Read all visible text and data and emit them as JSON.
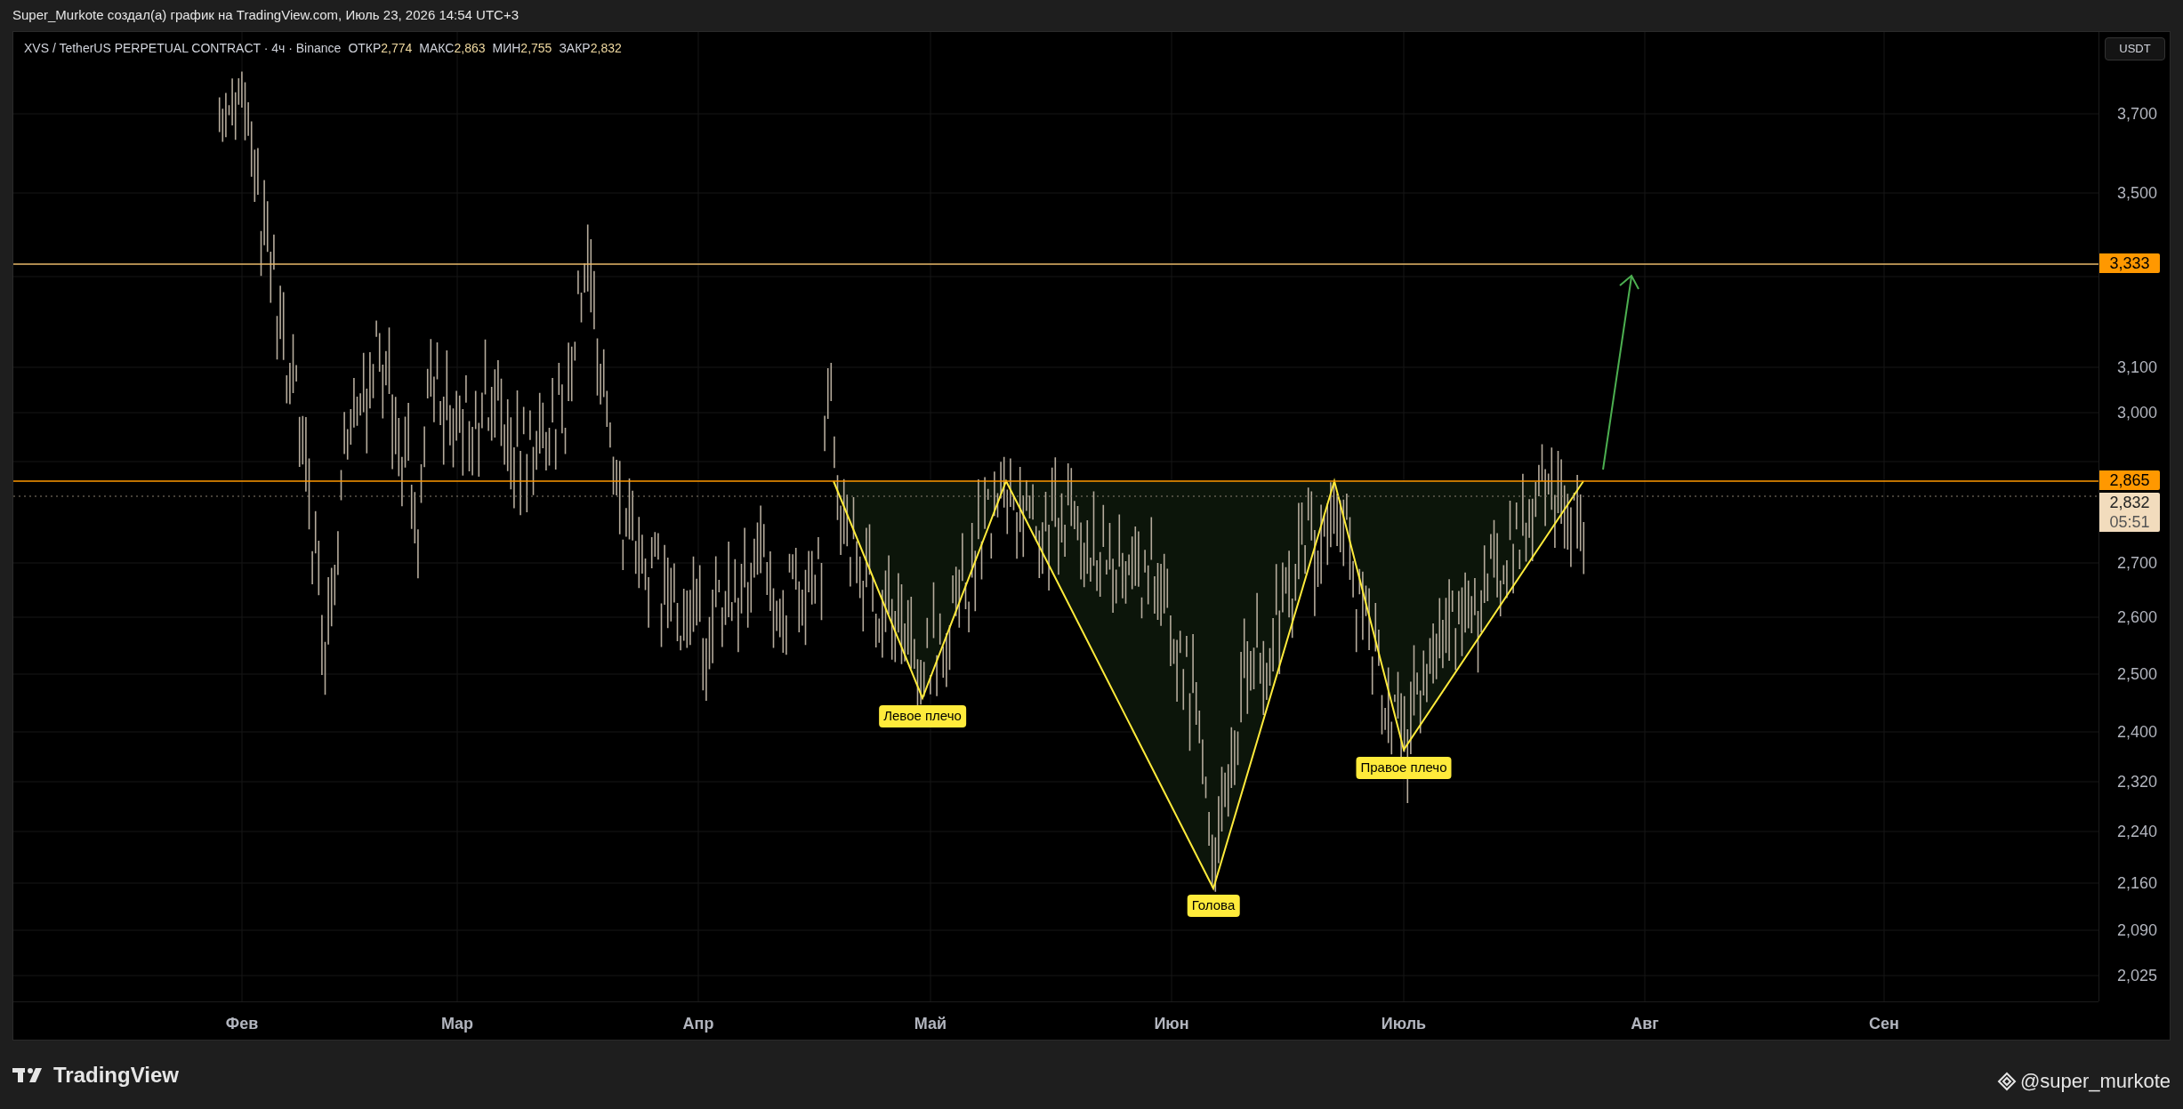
{
  "header": {
    "title": "Super_Murkote создал(а) график на TradingView.com, Июль 23, 2026 14:54 UTC+3"
  },
  "legend": {
    "symbol": "XVS / TetherUS PERPETUAL CONTRACT · 4ч · Binance",
    "values": [
      {
        "label": "ОТКР",
        "value": "2,774"
      },
      {
        "label": "МАКС",
        "value": "2,863"
      },
      {
        "label": "МИН",
        "value": "2,755"
      },
      {
        "label": "ЗАКР",
        "value": "2,832"
      }
    ]
  },
  "currency_button": "USDT",
  "price_axis": {
    "ticks": [
      "3,700",
      "3,500",
      "3,100",
      "3,000",
      "2,700",
      "2,600",
      "2,500",
      "2,400",
      "2,320",
      "2,240",
      "2,160",
      "2,090",
      "2,025"
    ]
  },
  "price_labels": [
    {
      "kind": "alert",
      "value": "3,333"
    },
    {
      "kind": "level",
      "value": "2,865"
    },
    {
      "kind": "last",
      "value": "2,832",
      "countdown": "05:51"
    }
  ],
  "time_axis": [
    "Фев",
    "Мар",
    "Апр",
    "Май",
    "Июн",
    "Июль",
    "Авг",
    "Сен"
  ],
  "pattern_labels": [
    "Левое плечо",
    "Голова",
    "Правое плечо"
  ],
  "footer": {
    "brand": "TradingView",
    "author": "@super_murkote"
  }
}
